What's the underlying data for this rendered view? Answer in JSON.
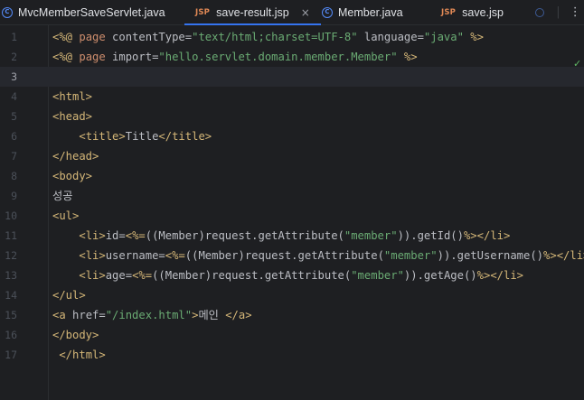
{
  "tabs": [
    {
      "label": "MvcMemberSaveServlet.java",
      "icon": "class-icon",
      "active": false
    },
    {
      "label": "save-result.jsp",
      "icon": "JSP",
      "active": true
    },
    {
      "label": "Member.java",
      "icon": "class-icon",
      "active": false
    },
    {
      "label": "save.jsp",
      "icon": "JSP",
      "active": false
    }
  ],
  "tab_close_glyph": "×",
  "tab_menu_glyph": "⋮",
  "inspection_glyph": "✓",
  "colors": {
    "background": "#1e1f22",
    "accent": "#3574f0",
    "directive": "#d5b778",
    "string": "#6aab73",
    "text": "#bcbec4",
    "line_number": "#4b5059",
    "inspection_ok": "#5fb865"
  },
  "editor": {
    "current_line": 3,
    "lines": [
      {
        "n": "1",
        "segs": [
          [
            "t-dir",
            "<%@ "
          ],
          [
            "t-kw",
            "page "
          ],
          [
            "t-attr",
            "contentType="
          ],
          [
            "t-str",
            "\"text/html;charset=UTF-8\""
          ],
          [
            "t-attr",
            " language="
          ],
          [
            "t-str",
            "\"java\""
          ],
          [
            "t-dir",
            " %>"
          ]
        ]
      },
      {
        "n": "2",
        "segs": [
          [
            "t-dir",
            "<%@ "
          ],
          [
            "t-kw",
            "page "
          ],
          [
            "t-attr",
            "import="
          ],
          [
            "t-str",
            "\"hello.servlet.domain.member.Member\""
          ],
          [
            "t-dir",
            " %>"
          ]
        ]
      },
      {
        "n": "3",
        "segs": []
      },
      {
        "n": "4",
        "segs": [
          [
            "t-tag",
            "<html>"
          ]
        ]
      },
      {
        "n": "5",
        "segs": [
          [
            "t-tag",
            "<head>"
          ]
        ]
      },
      {
        "n": "6",
        "segs": [
          [
            "t-text",
            "    "
          ],
          [
            "t-tag",
            "<title>"
          ],
          [
            "t-text",
            "Title"
          ],
          [
            "t-tag",
            "</title>"
          ]
        ]
      },
      {
        "n": "7",
        "segs": [
          [
            "t-tag",
            "</head>"
          ]
        ]
      },
      {
        "n": "8",
        "segs": [
          [
            "t-tag",
            "<body>"
          ]
        ]
      },
      {
        "n": "9",
        "segs": [
          [
            "t-text",
            "성공"
          ]
        ]
      },
      {
        "n": "10",
        "segs": [
          [
            "t-tag",
            "<ul>"
          ]
        ]
      },
      {
        "n": "11",
        "segs": [
          [
            "t-text",
            "    "
          ],
          [
            "t-tag",
            "<li>"
          ],
          [
            "t-text",
            "id="
          ],
          [
            "t-dir",
            "<%="
          ],
          [
            "t-java",
            "((Member)request.getAttribute("
          ],
          [
            "t-jstr",
            "\"member\""
          ],
          [
            "t-java",
            ")).getId()"
          ],
          [
            "t-dir",
            "%>"
          ],
          [
            "t-tag",
            "</li>"
          ]
        ]
      },
      {
        "n": "12",
        "segs": [
          [
            "t-text",
            "    "
          ],
          [
            "t-tag",
            "<li>"
          ],
          [
            "t-text",
            "username="
          ],
          [
            "t-dir",
            "<%="
          ],
          [
            "t-java",
            "((Member)request.getAttribute("
          ],
          [
            "t-jstr",
            "\"member\""
          ],
          [
            "t-java",
            ")).getUsername()"
          ],
          [
            "t-dir",
            "%>"
          ],
          [
            "t-tag",
            "</li>"
          ]
        ]
      },
      {
        "n": "13",
        "segs": [
          [
            "t-text",
            "    "
          ],
          [
            "t-tag",
            "<li>"
          ],
          [
            "t-text",
            "age="
          ],
          [
            "t-dir",
            "<%="
          ],
          [
            "t-java",
            "((Member)request.getAttribute("
          ],
          [
            "t-jstr",
            "\"member\""
          ],
          [
            "t-java",
            ")).getAge()"
          ],
          [
            "t-dir",
            "%>"
          ],
          [
            "t-tag",
            "</li>"
          ]
        ]
      },
      {
        "n": "14",
        "segs": [
          [
            "t-tag",
            "</ul>"
          ]
        ]
      },
      {
        "n": "15",
        "segs": [
          [
            "t-tag",
            "<a "
          ],
          [
            "t-attr",
            "href="
          ],
          [
            "t-str",
            "\"/index.html\""
          ],
          [
            "t-tag",
            ">"
          ],
          [
            "t-text",
            "메인 "
          ],
          [
            "t-tag",
            "</a>"
          ]
        ]
      },
      {
        "n": "16",
        "segs": [
          [
            "t-tag",
            "</body>"
          ]
        ]
      },
      {
        "n": "17",
        "segs": [
          [
            "t-text",
            " "
          ],
          [
            "t-tag",
            "</html>"
          ]
        ]
      }
    ]
  }
}
